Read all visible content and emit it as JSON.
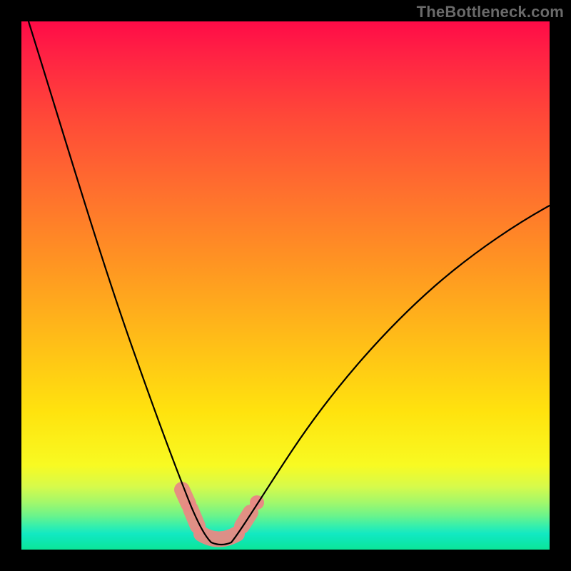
{
  "watermark": "TheBottleneck.com",
  "colors": {
    "page_bg": "#000000",
    "curve": "#000000",
    "marker": "#e88a84",
    "gradient_top": "#ff0b47",
    "gradient_bottom": "#0ce598"
  },
  "chart_data": {
    "type": "line",
    "title": "",
    "xlabel": "",
    "ylabel": "",
    "xlim": [
      0,
      100
    ],
    "ylim": [
      0,
      100
    ],
    "grid": false,
    "series": [
      {
        "name": "left-curve",
        "x": [
          0,
          4,
          8,
          12,
          16,
          20,
          24,
          26,
          28,
          30,
          32,
          33,
          34
        ],
        "y": [
          100,
          90,
          80,
          69,
          58,
          46,
          32,
          25,
          18,
          12,
          6,
          3,
          1
        ]
      },
      {
        "name": "right-curve",
        "x": [
          40,
          42,
          45,
          50,
          56,
          62,
          70,
          78,
          86,
          94,
          100
        ],
        "y": [
          1,
          3,
          7,
          14,
          22,
          30,
          39,
          47,
          54,
          60,
          64
        ]
      },
      {
        "name": "valley-floor",
        "x": [
          34,
          36,
          38,
          40
        ],
        "y": [
          1,
          0.3,
          0.3,
          1
        ]
      }
    ],
    "annotations": [
      {
        "name": "left-marker-segment",
        "x_range": [
          30,
          33
        ],
        "y_range": [
          12,
          3
        ]
      },
      {
        "name": "right-marker-segment",
        "x_range": [
          41,
          43.5
        ],
        "y_range": [
          2,
          5
        ]
      },
      {
        "name": "valley-marker",
        "x_range": [
          33,
          41
        ],
        "y_range": [
          2,
          2
        ]
      }
    ]
  }
}
